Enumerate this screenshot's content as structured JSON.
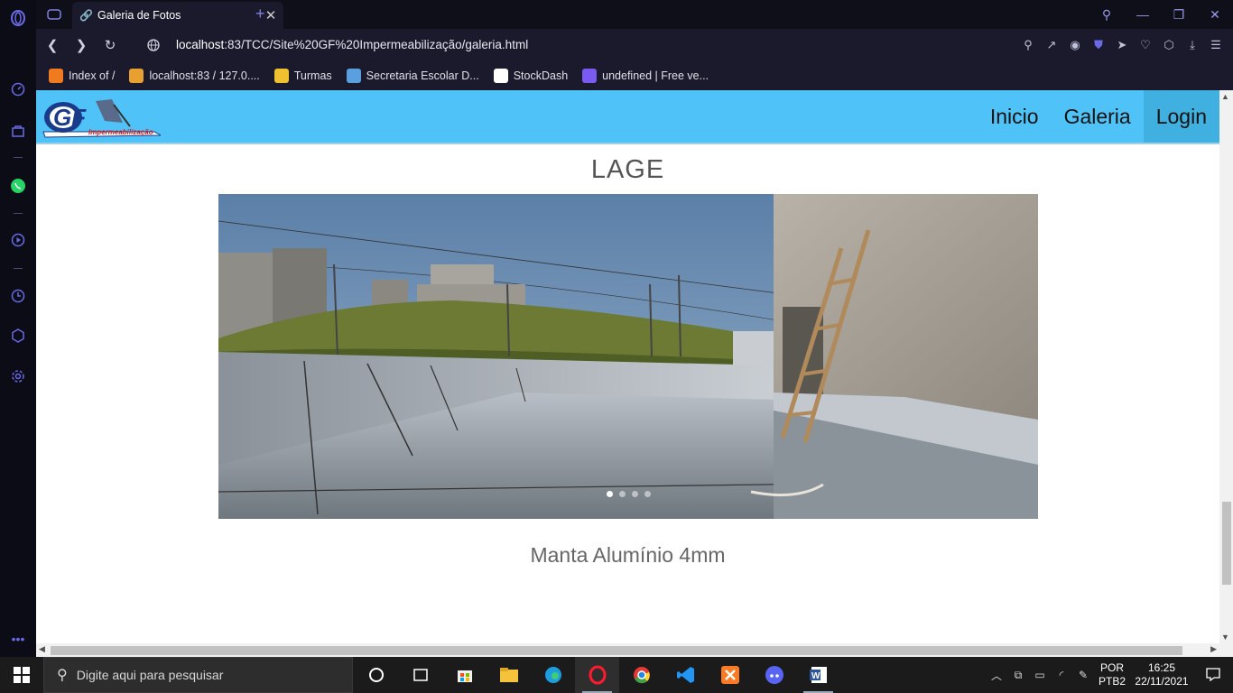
{
  "browser": {
    "tab_title": "Galeria de Fotos",
    "url_host": "localhost",
    "url_rest": ":83/TCC/Site%20GF%20Impermeabilização/galeria.html",
    "bookmarks": [
      {
        "label": "Index of /",
        "color": "#f07a20"
      },
      {
        "label": "localhost:83 / 127.0....",
        "color": "#e8a030"
      },
      {
        "label": "Turmas",
        "color": "#f0c030"
      },
      {
        "label": "Secretaria Escolar D...",
        "color": "#5aa0e0"
      },
      {
        "label": "StockDash",
        "color": "#ffffff"
      },
      {
        "label": "undefined | Free ve...",
        "color": "#7a5af0"
      }
    ]
  },
  "site": {
    "logo_text": "GF",
    "logo_sub": "Impermeabilização",
    "nav": {
      "inicio": "Inicio",
      "galeria": "Galeria",
      "login": "Login"
    },
    "section_title": "LAGE",
    "caption": "Manta Alumínio 4mm",
    "slides": {
      "count": 4,
      "active": 1
    },
    "colors": {
      "navbar": "#4fc3f7",
      "nav_active": "#3fb0e0"
    }
  },
  "taskbar": {
    "search_placeholder": "Digite aqui para pesquisar",
    "lang_top": "POR",
    "lang_bottom": "PTB2",
    "time": "16:25",
    "date": "22/11/2021"
  }
}
